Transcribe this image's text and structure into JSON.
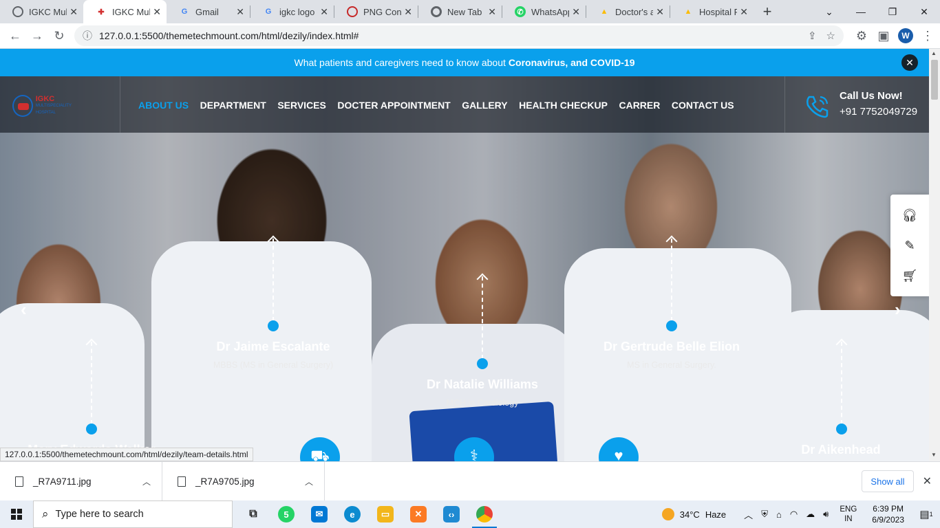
{
  "browser": {
    "tabs": [
      {
        "label": "IGKC Multi",
        "favicon": "globe-icon",
        "color": "#5f6368",
        "active": false
      },
      {
        "label": "IGKC Multi",
        "favicon": "igkc-logo-icon",
        "color": "#d32f2f",
        "active": true
      },
      {
        "label": "Gmail",
        "favicon": "google-icon",
        "color": "#4285f4",
        "active": false
      },
      {
        "label": "igkc logo -",
        "favicon": "google-icon",
        "color": "#4285f4",
        "active": false
      },
      {
        "label": "PNG Conv",
        "favicon": "png-converter-icon",
        "color": "#c62828",
        "active": false
      },
      {
        "label": "New Tab",
        "favicon": "chrome-icon",
        "color": "#5f6368",
        "active": false
      },
      {
        "label": "WhatsApp",
        "favicon": "whatsapp-icon",
        "color": "#25d366",
        "active": false
      },
      {
        "label": "Doctor's ap",
        "favicon": "google-drive-icon",
        "color": "#fbbc04",
        "active": false
      },
      {
        "label": "Hospital P",
        "favicon": "google-drive-icon",
        "color": "#fbbc04",
        "active": false
      }
    ],
    "url": "127.0.0.1:5500/themetechmount.com/html/dezily/index.html#",
    "profile_initial": "W",
    "status_url": "127.0.0.1:5500/themetechmount.com/html/dezily/team-details.html"
  },
  "site": {
    "notice_text": "What patients and caregivers need to know about",
    "notice_bold": "Coronavirus, and COVID-19",
    "logo_text": "IGKC",
    "logo_sub": "MULTISPECIALITY HOSPITAL",
    "menu": [
      "ABOUT US",
      "DEPARTMENT",
      "SERVICES",
      "DOCTER APPOINTMENT",
      "GALLERY",
      "HEALTH CHECKUP",
      "CARRER",
      "CONTACT US"
    ],
    "active_menu": "ABOUT US",
    "call_title": "Call Us Now!",
    "call_number": "+91 7752049729",
    "accent": "#0aa0ec",
    "doctors": [
      {
        "name": "Dr Jaime Escalante",
        "qual": "MBBS (MS in General Surgery)"
      },
      {
        "name": "Dr Natalie Williams",
        "qual": "MCH in Cardiology"
      },
      {
        "name": "Dr Gertrude Belle Elion",
        "qual": "MS in General Surgery."
      },
      {
        "name": "Mary Edwards Walker",
        "qual": ""
      },
      {
        "name": "Dr Aikenhead",
        "qual": ""
      }
    ]
  },
  "downloads": {
    "items": [
      "_R7A9711.jpg",
      "_R7A9705.jpg"
    ],
    "show_all": "Show all"
  },
  "taskbar": {
    "search_placeholder": "Type here to search",
    "whatsapp_badge": "5",
    "temperature": "34°C",
    "weather": "Haze",
    "lang_top": "ENG",
    "lang_bottom": "IN",
    "time": "6:39 PM",
    "date": "6/9/2023",
    "notif_count": "1"
  }
}
